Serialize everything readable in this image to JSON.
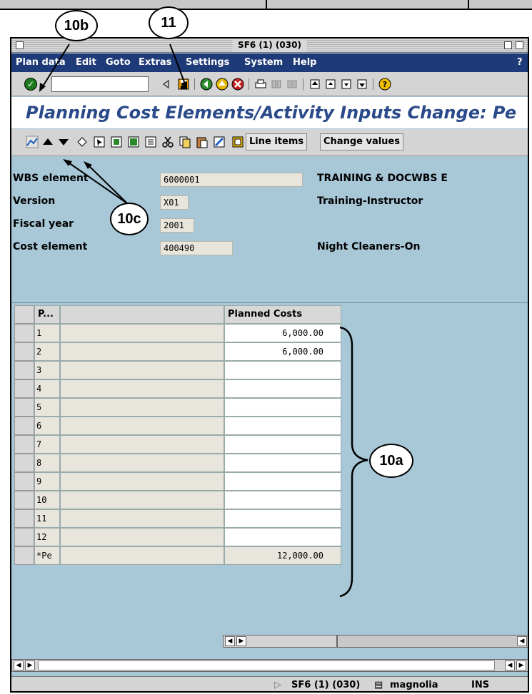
{
  "window": {
    "title": "SF6 (1) (030)"
  },
  "menu": [
    "Plan data",
    "Edit",
    "Goto",
    "Extras",
    "Settings",
    "System",
    "Help",
    "?"
  ],
  "app_title": "Planning Cost Elements/Activity Inputs Change: Pe",
  "app_toolbar": {
    "line_items_label": "Line items",
    "change_values_label": "Change values"
  },
  "header_fields": [
    {
      "label": "WBS element",
      "value": "6000001",
      "desc": "TRAINING & DOCWBS E"
    },
    {
      "label": "Version",
      "value": "X01",
      "desc": "Training-Instructor"
    },
    {
      "label": "Fiscal year",
      "value": "2001",
      "desc": ""
    },
    {
      "label": "Cost element",
      "value": "400490",
      "desc": "Night Cleaners-On"
    }
  ],
  "grid": {
    "col_period": "P...",
    "col_desc": "",
    "col_planned": "Planned Costs",
    "rows": [
      {
        "period": "1",
        "planned": "6,000.00"
      },
      {
        "period": "2",
        "planned": "6,000.00"
      },
      {
        "period": "3",
        "planned": ""
      },
      {
        "period": "4",
        "planned": ""
      },
      {
        "period": "5",
        "planned": ""
      },
      {
        "period": "6",
        "planned": ""
      },
      {
        "period": "7",
        "planned": ""
      },
      {
        "period": "8",
        "planned": ""
      },
      {
        "period": "9",
        "planned": ""
      },
      {
        "period": "10",
        "planned": ""
      },
      {
        "period": "11",
        "planned": ""
      },
      {
        "period": "12",
        "planned": ""
      }
    ],
    "total_label": "*Pe",
    "total_value": "12,000.00"
  },
  "status": {
    "session": "SF6 (1) (030)",
    "server": "magnolia",
    "mode": "INS"
  },
  "callouts": {
    "c10b": "10b",
    "c11": "11",
    "c10c": "10c",
    "c10a": "10a"
  }
}
